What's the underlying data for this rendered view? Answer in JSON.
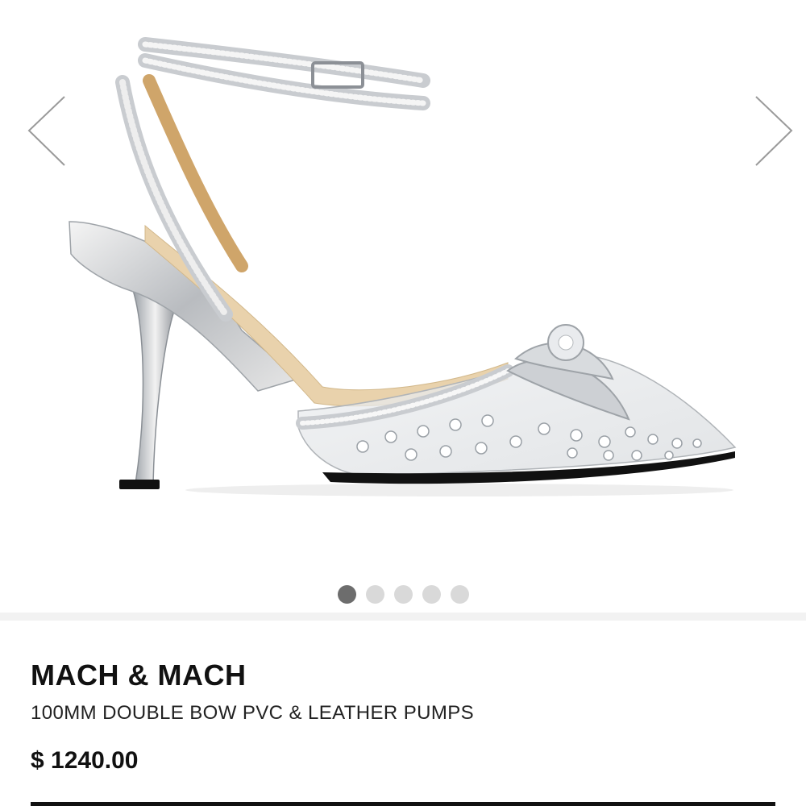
{
  "gallery": {
    "prev_icon": "chevron-left-icon",
    "next_icon": "chevron-right-icon",
    "image_alt": "",
    "dots": [
      {
        "active": true
      },
      {
        "active": false
      },
      {
        "active": false
      },
      {
        "active": false
      },
      {
        "active": false
      }
    ]
  },
  "product": {
    "brand": "MACH & MACH",
    "name": "100MM DOUBLE BOW PVC & LEATHER PUMPS",
    "price": "$ 1240.00"
  },
  "colors": {
    "active_dot": "#6d6d6d",
    "inactive_dot": "#d9d9d9",
    "text": "#111111"
  }
}
